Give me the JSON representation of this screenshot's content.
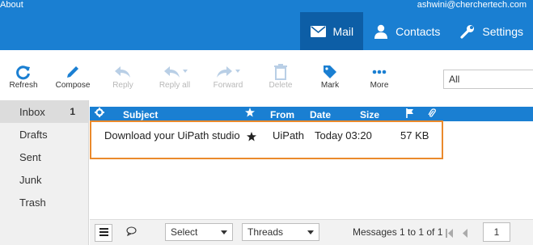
{
  "header": {
    "about": "About",
    "user_email": "ashwini@cherchertech.com",
    "nav": [
      {
        "label": "Mail",
        "icon": "envelope-icon",
        "active": true
      },
      {
        "label": "Contacts",
        "icon": "person-icon",
        "active": false
      },
      {
        "label": "Settings",
        "icon": "wrench-icon",
        "active": false
      }
    ]
  },
  "toolbar": {
    "refresh": "Refresh",
    "compose": "Compose",
    "reply": "Reply",
    "reply_all": "Reply all",
    "forward": "Forward",
    "delete": "Delete",
    "mark": "Mark",
    "more": "More",
    "filter_value": "All"
  },
  "sidebar": {
    "folders": [
      {
        "label": "Inbox",
        "count": "1"
      },
      {
        "label": "Drafts",
        "count": ""
      },
      {
        "label": "Sent",
        "count": ""
      },
      {
        "label": "Junk",
        "count": ""
      },
      {
        "label": "Trash",
        "count": ""
      }
    ]
  },
  "message_list": {
    "columns": {
      "subject": "Subject",
      "from": "From",
      "date": "Date",
      "size": "Size"
    },
    "rows": [
      {
        "subject": "Download your UiPath studio",
        "from": "UiPath",
        "date": "Today 03:20",
        "size": "57 KB"
      }
    ]
  },
  "footer": {
    "select": "Select",
    "threads": "Threads",
    "pager": "Messages 1 to 1 of 1",
    "page": "1"
  },
  "colors": {
    "accent": "#1a7fd2",
    "accent_dark": "#0d5ea6",
    "highlight": "#ea8a2c"
  }
}
